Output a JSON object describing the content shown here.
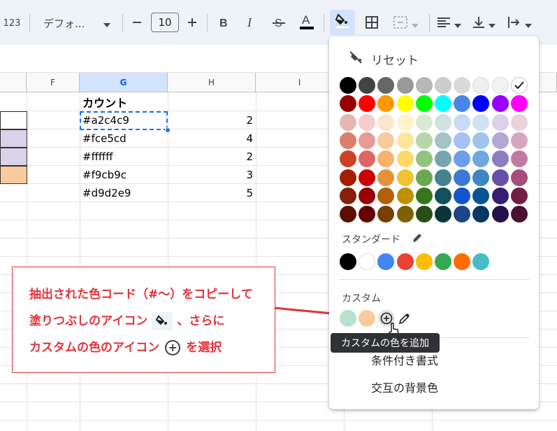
{
  "toolbar": {
    "format_label": "123",
    "font_family": "デフォ...",
    "font_size": "10"
  },
  "columns": [
    "F",
    "G",
    "H",
    "I"
  ],
  "sheet": {
    "header": "カウント",
    "rows": [
      {
        "color": "#a2c4c9",
        "count": "2"
      },
      {
        "color": "#fce5cd",
        "count": "4"
      },
      {
        "color": "#ffffff",
        "count": "2"
      },
      {
        "color": "#f9cb9c",
        "count": "3"
      },
      {
        "color": "#d9d2e9",
        "count": "5"
      }
    ]
  },
  "callout": {
    "line1": "抽出された色コード（#～）をコピーして",
    "line2_a": "塗りつぶしのアイコン",
    "line2_b": "、さらに",
    "line3_a": "カスタムの色のアイコン",
    "line3_b": "を選択"
  },
  "color_menu": {
    "reset_label": "リセット",
    "standard_label": "スタンダード",
    "custom_label": "カスタム",
    "conditional_format": "条件付き書式",
    "alternating_colors": "交互の背景色",
    "tooltip": "カスタムの色を追加",
    "palette": [
      [
        "#000000",
        "#434343",
        "#666666",
        "#999999",
        "#b7b7b7",
        "#cccccc",
        "#d9d9d9",
        "#efefef",
        "#f3f3f3",
        "#ffffff"
      ],
      [
        "#980000",
        "#ff0000",
        "#ff9900",
        "#ffff00",
        "#00ff00",
        "#00ffff",
        "#4a86e8",
        "#0000ff",
        "#9900ff",
        "#ff00ff"
      ],
      [
        "#e6b8af",
        "#f4cccc",
        "#fce5cd",
        "#fff2cc",
        "#d9ead3",
        "#d0e0e3",
        "#c9daf8",
        "#cfe2f3",
        "#d9d2e9",
        "#ead1dc"
      ],
      [
        "#dd7e6b",
        "#ea9999",
        "#f9cb9c",
        "#ffe599",
        "#b6d7a8",
        "#a2c4c9",
        "#a4c2f4",
        "#9fc5e8",
        "#b4a7d6",
        "#d5a6bd"
      ],
      [
        "#cc4125",
        "#e06666",
        "#f6b26b",
        "#ffd966",
        "#93c47d",
        "#76a5af",
        "#6d9eeb",
        "#6fa8dc",
        "#8e7cc3",
        "#c27ba0"
      ],
      [
        "#a61c00",
        "#cc0000",
        "#e69138",
        "#f1c232",
        "#6aa84f",
        "#45818e",
        "#3c78d8",
        "#3d85c6",
        "#674ea7",
        "#a64d79"
      ],
      [
        "#85200c",
        "#990000",
        "#b45f06",
        "#bf9000",
        "#38761d",
        "#134f5c",
        "#1155cc",
        "#0b5394",
        "#351c75",
        "#741b47"
      ],
      [
        "#5b0f00",
        "#660000",
        "#783f04",
        "#7f6000",
        "#274e13",
        "#0c343d",
        "#1c4587",
        "#073763",
        "#20124d",
        "#4c1130"
      ]
    ],
    "standard": [
      "#000000",
      "#ffffff",
      "#4285f4",
      "#ea4335",
      "#fbbc04",
      "#34a853",
      "#ff6d01",
      "#46bdc6"
    ],
    "custom": [
      "#b7e1cd",
      "#f9cb9c"
    ]
  },
  "colors": {
    "accent": "#1a73e8",
    "callout_red": "#e0343b"
  },
  "icons": [
    "minus-icon",
    "plus-icon",
    "bold-icon",
    "italic-icon",
    "strikethrough-icon",
    "text-color-icon",
    "fill-color-icon",
    "borders-icon",
    "merge-cells-icon",
    "horizontal-align-icon",
    "vertical-align-icon",
    "text-wrap-icon",
    "reset-fill-icon",
    "pencil-icon",
    "add-custom-color-icon",
    "eyedropper-icon",
    "cursor-hand-icon",
    "checkmark-icon"
  ]
}
